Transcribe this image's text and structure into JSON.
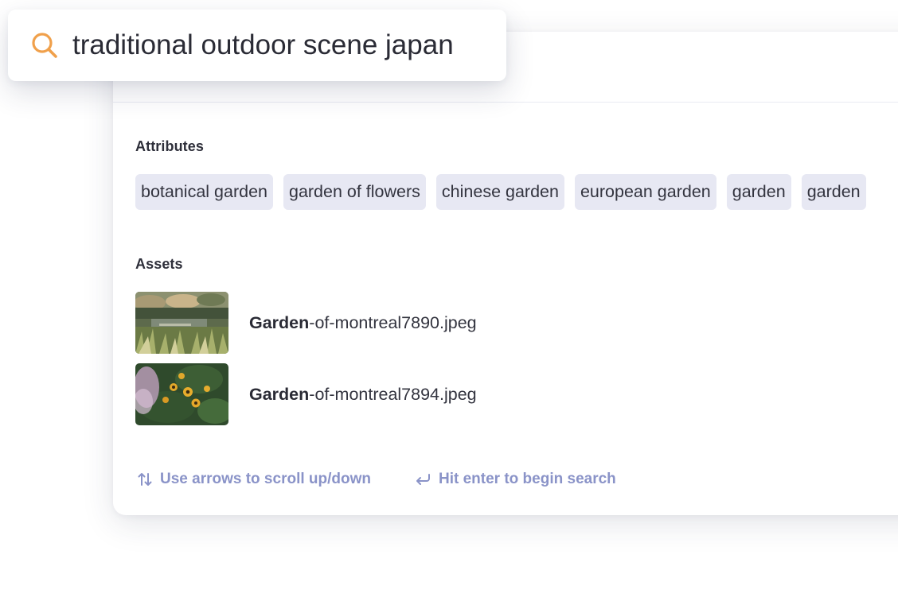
{
  "search": {
    "query": "traditional outdoor scene japan",
    "icon": "search-icon",
    "icon_color": "#f0a04b"
  },
  "attributes": {
    "title": "Attributes",
    "chips": [
      "botanical garden",
      "garden of flowers",
      "chinese garden",
      "european garden",
      "garden",
      "garden"
    ]
  },
  "assets": {
    "title": "Assets",
    "items": [
      {
        "name_bold": "Garden",
        "name_rest": "-of-montreal7890.jpeg"
      },
      {
        "name_bold": "Garden",
        "name_rest": "-of-montreal7894.jpeg"
      }
    ]
  },
  "hints": {
    "scroll": "Use arrows to scroll up/down",
    "scroll_icon": "up-down-arrows-icon",
    "enter": "Hit enter to begin search",
    "enter_icon": "return-arrow-icon"
  },
  "colors": {
    "chip_bg": "#e7e8f3",
    "hint_text": "#8a93c8",
    "accent": "#f0a04b"
  }
}
